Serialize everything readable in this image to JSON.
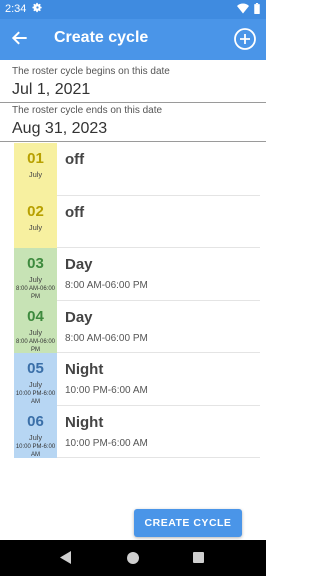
{
  "status_bar": {
    "time": "2:34",
    "icons": [
      "gear-icon",
      "wifi-icon",
      "battery-icon"
    ]
  },
  "app_bar": {
    "title": "Create cycle",
    "back_icon": "arrow-left-icon",
    "add_icon": "plus-circle-icon"
  },
  "start": {
    "label": "The roster cycle begins on this date",
    "value": "Jul 1, 2021"
  },
  "end": {
    "label": "The roster cycle ends on this date",
    "value": "Aug 31, 2023"
  },
  "days": [
    {
      "num": "01",
      "month": "July",
      "time": "",
      "shift": "off",
      "shift_time": "",
      "color": "#f7f0a0"
    },
    {
      "num": "02",
      "month": "July",
      "time": "",
      "shift": "off",
      "shift_time": "",
      "color": "#f7f0a0"
    },
    {
      "num": "03",
      "month": "July",
      "time": "8:00 AM-06:00 PM",
      "shift": "Day",
      "shift_time": "8:00 AM-06:00 PM",
      "color": "#c7e3b5"
    },
    {
      "num": "04",
      "month": "July",
      "time": "8:00 AM-06:00 PM",
      "shift": "Day",
      "shift_time": "8:00 AM-06:00 PM",
      "color": "#c7e3b5"
    },
    {
      "num": "05",
      "month": "July",
      "time": "10:00 PM-6:00 AM",
      "shift": "Night",
      "shift_time": "10:00 PM-6:00 AM",
      "color": "#b7d6f3"
    },
    {
      "num": "06",
      "month": "July",
      "time": "10:00 PM-6:00 AM",
      "shift": "Night",
      "shift_time": "10:00 PM-6:00 AM",
      "color": "#b7d6f3"
    }
  ],
  "button": {
    "label": "CREATE CYCLE"
  },
  "nav": {
    "icons": [
      "back-triangle-icon",
      "home-circle-icon",
      "recents-square-icon"
    ]
  }
}
